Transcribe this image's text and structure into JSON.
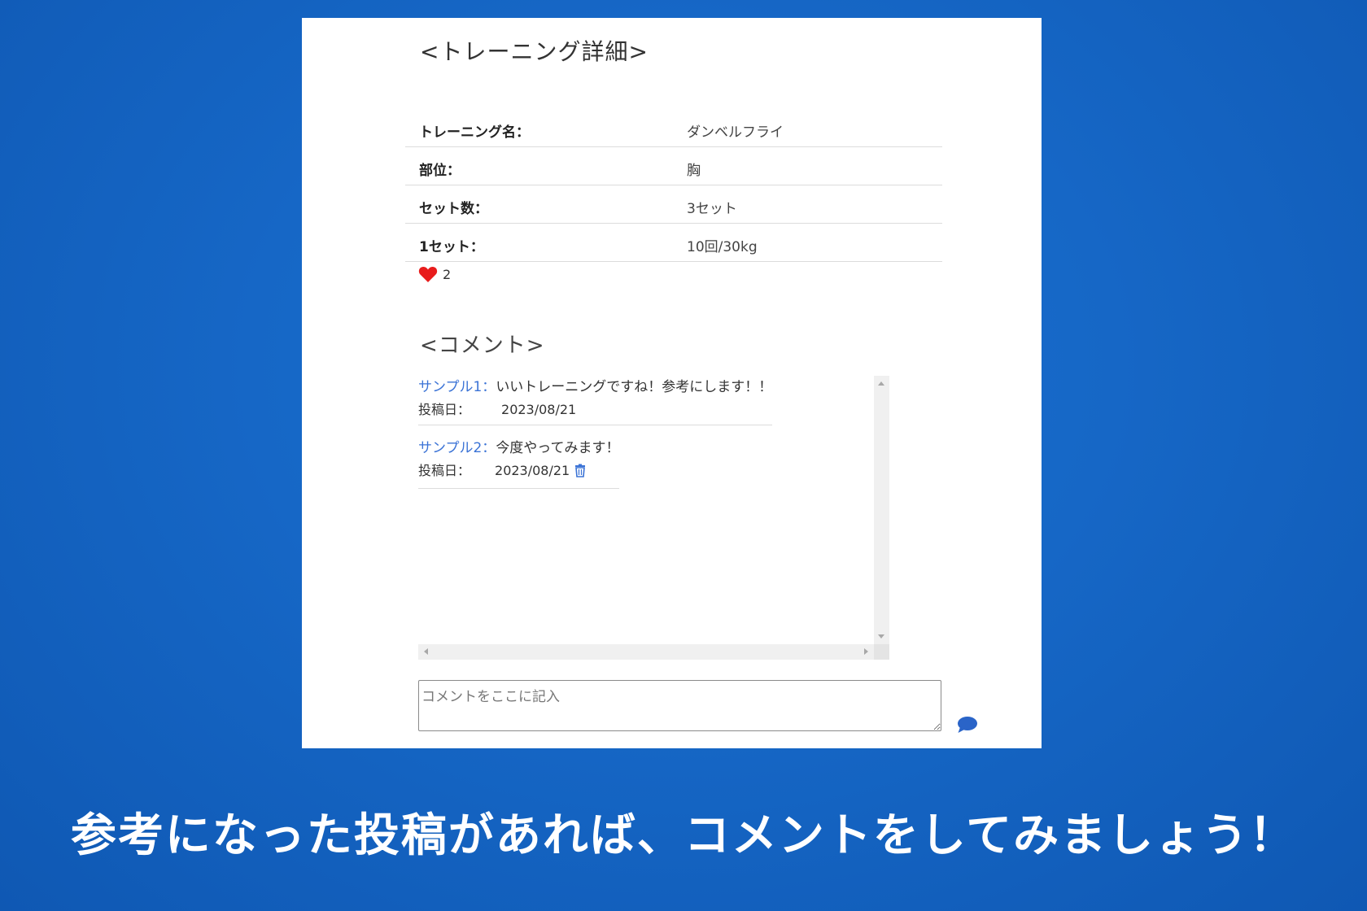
{
  "detail": {
    "title": "<トレーニング詳細>",
    "rows": [
      {
        "label": "トレーニング名：",
        "value": "ダンベルフライ"
      },
      {
        "label": "部位：",
        "value": "胸"
      },
      {
        "label": "セット数：",
        "value": "3セット"
      },
      {
        "label": "1セット：",
        "value": "10回/30kg"
      }
    ],
    "like_count": "2",
    "like_color": "#e81c1c"
  },
  "comments": {
    "title": "<コメント>",
    "date_label": "投稿日：",
    "items": [
      {
        "user": "サンプル1：",
        "text": "いいトレーニングですね！参考にします！！",
        "date": "2023/08/21",
        "deletable": false
      },
      {
        "user": "サンプル2：",
        "text": "今度やってみます！",
        "date": "2023/08/21",
        "deletable": true
      }
    ],
    "input_placeholder": "コメントをここに記入",
    "user_color": "#3b73d6",
    "send_icon": "comment-bubble-icon",
    "delete_icon": "trash-icon"
  },
  "caption": "参考になった投稿があれば、コメントをしてみましょう！"
}
